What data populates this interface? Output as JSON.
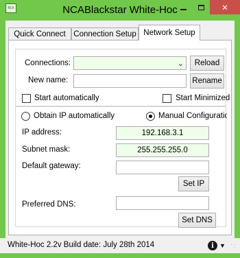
{
  "window": {
    "title": "NCABlackstar White-Hoc",
    "icon_label": "NCA",
    "controls": {
      "minimize": "minimize-icon",
      "maximize": "maximize-icon",
      "close": "close-icon",
      "close_glyph": "✕"
    },
    "colors": {
      "frame": "#72c84a",
      "close": "#c7504a",
      "field_fill": "#f0fdea"
    }
  },
  "tabs": [
    {
      "label": "Quick Connect",
      "active": false
    },
    {
      "label": "Connection Setup",
      "active": false
    },
    {
      "label": "Network Setup",
      "active": true
    }
  ],
  "connection": {
    "connections_label": "Connections:",
    "connections_value": "",
    "reload_label": "Reload",
    "new_name_label": "New name:",
    "new_name_value": "",
    "rename_label": "Rename",
    "start_auto_label": "Start automatically",
    "start_auto_checked": false,
    "start_min_label": "Start Minimized",
    "start_min_checked": false
  },
  "ip": {
    "obtain_auto_label": "Obtain IP automatically",
    "obtain_auto_selected": false,
    "manual_label": "Manual Configuration",
    "manual_selected": true,
    "ip_label": "IP address:",
    "ip_value": "192.168.3.1",
    "mask_label": "Subnet mask:",
    "mask_value": "255.255.255.0",
    "gateway_label": "Default gateway:",
    "gateway_value": "",
    "set_ip_label": "Set IP",
    "dns_label": "Preferred DNS:",
    "dns_value": "",
    "set_dns_label": "Set DNS"
  },
  "status": {
    "text": "White-Hoc 2.2v  Build date: July 28th 2014",
    "info_icon": "info-icon",
    "info_glyph": "i",
    "dropdown_icon": "chevron-down-icon",
    "dropdown_glyph": "▼"
  }
}
